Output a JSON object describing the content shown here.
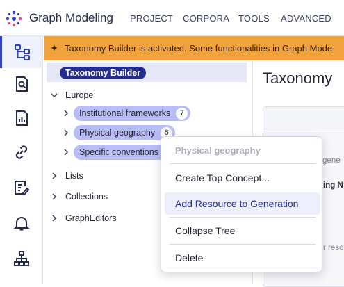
{
  "app": {
    "title": "Graph Modeling",
    "brand_color": "#2f3fbf"
  },
  "menu": [
    "PROJECT",
    "CORPORA",
    "TOOLS",
    "ADVANCED"
  ],
  "rail": [
    {
      "icon": "tree-structure-icon",
      "active": true
    },
    {
      "icon": "document-search-icon",
      "active": false
    },
    {
      "icon": "report-chart-icon",
      "active": false
    },
    {
      "icon": "link-icon",
      "active": false
    },
    {
      "icon": "edit-checklist-icon",
      "active": false
    },
    {
      "icon": "bell-icon",
      "active": false
    },
    {
      "icon": "hierarchy-icon",
      "active": false
    }
  ],
  "banner": {
    "text": "Taxonomy Builder is activated. Some functionalities in Graph Mode",
    "color": "#f2a23c"
  },
  "tree": {
    "header": "Taxonomy Builder",
    "nodes": [
      {
        "label": "Europe",
        "expanded": true
      },
      {
        "label": "Institutional frameworks",
        "count": "7"
      },
      {
        "label": "Physical geography",
        "count": "6"
      },
      {
        "label": "Specific conventions",
        "count": ""
      },
      {
        "label": "Lists"
      },
      {
        "label": "Collections"
      },
      {
        "label": "GraphEditors"
      }
    ]
  },
  "right": {
    "title": "Taxonomy",
    "frag1": "r gene",
    "frag2": "ing N",
    "frag3": "r reso"
  },
  "context_menu": {
    "header": "Physical geography",
    "items": [
      "Create Top Concept...",
      "Add Resource to Generation",
      "Collapse Tree",
      "Delete"
    ]
  }
}
